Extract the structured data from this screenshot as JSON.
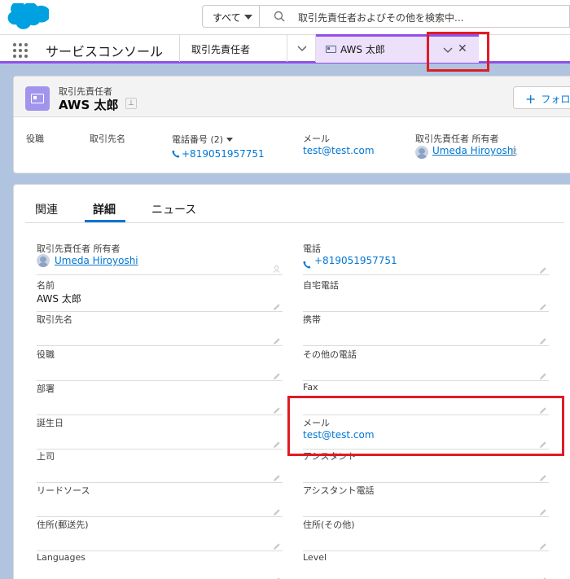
{
  "search": {
    "scope_label": "すべて",
    "placeholder": "取引先責任者およびその他を検索中..."
  },
  "nav": {
    "app_name": "サービスコンソール",
    "tabs": [
      {
        "label": "取引先責任者"
      },
      {
        "label": "AWS 太郎"
      }
    ]
  },
  "record": {
    "type_label": "取引先責任者",
    "name": "AWS 太郎",
    "follow_label": "フォロ",
    "highlights": {
      "title_label": "役職",
      "account_label": "取引先名",
      "phone_label": "電話番号 (2)",
      "phone_value": "+819051957751",
      "email_label": "メール",
      "email_value": "test@test.com",
      "owner_label": "取引先責任者 所有者",
      "owner_value": "Umeda Hiroyoshi"
    }
  },
  "detail": {
    "tabs": [
      "関連",
      "詳細",
      "ニュース"
    ],
    "fields_left": [
      {
        "label": "取引先責任者 所有者",
        "value": "Umeda Hiroyoshi"
      },
      {
        "label": "名前",
        "value": "AWS 太郎"
      },
      {
        "label": "取引先名",
        "value": ""
      },
      {
        "label": "役職",
        "value": ""
      },
      {
        "label": "部署",
        "value": ""
      },
      {
        "label": "誕生日",
        "value": ""
      },
      {
        "label": "上司",
        "value": ""
      },
      {
        "label": "リードソース",
        "value": ""
      },
      {
        "label": "住所(郵送先)",
        "value": ""
      },
      {
        "label": "Languages",
        "value": ""
      }
    ],
    "fields_right": [
      {
        "label": "電話",
        "value": "+819051957751"
      },
      {
        "label": "自宅電話",
        "value": ""
      },
      {
        "label": "携帯",
        "value": ""
      },
      {
        "label": "その他の電話",
        "value": ""
      },
      {
        "label": "Fax",
        "value": ""
      },
      {
        "label": "メール",
        "value": "test@test.com"
      },
      {
        "label": "アシスタント",
        "value": ""
      },
      {
        "label": "アシスタント電話",
        "value": ""
      },
      {
        "label": "住所(その他)",
        "value": ""
      },
      {
        "label": "Level",
        "value": ""
      }
    ]
  },
  "colors": {
    "accent": "#9050e9",
    "link": "#0176d3",
    "highlight_box": "#e01b24",
    "background": "#b0c4df"
  }
}
